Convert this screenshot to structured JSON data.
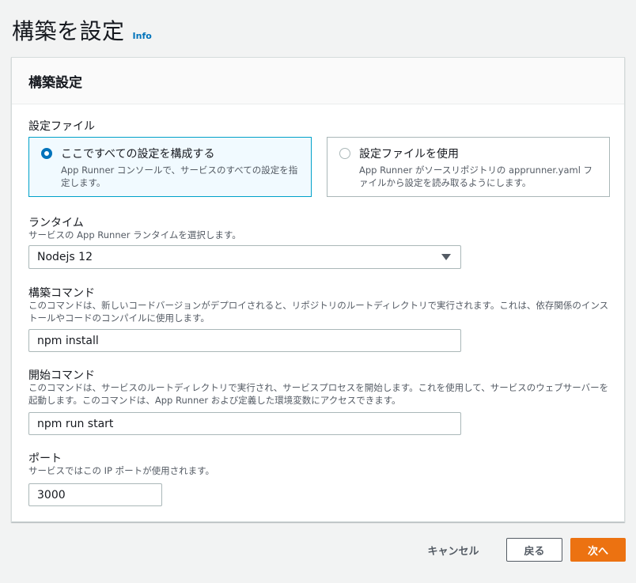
{
  "page": {
    "title": "構築を設定",
    "info_link": "Info"
  },
  "panel": {
    "title": "構築設定",
    "config_file": {
      "label": "設定ファイル",
      "options": [
        {
          "title": "ここですべての設定を構成する",
          "description": "App Runner コンソールで、サービスのすべての設定を指定します。",
          "selected": true
        },
        {
          "title": "設定ファイルを使用",
          "description": "App Runner がソースリポジトリの apprunner.yaml ファイルから設定を読み取るようにします。",
          "selected": false
        }
      ]
    },
    "runtime": {
      "label": "ランタイム",
      "description": "サービスの App Runner ランタイムを選択します。",
      "value": "Nodejs 12"
    },
    "build_command": {
      "label": "構築コマンド",
      "description": "このコマンドは、新しいコードバージョンがデプロイされると、リポジトリのルートディレクトリで実行されます。これは、依存関係のインストールやコードのコンパイルに使用します。",
      "value": "npm install"
    },
    "start_command": {
      "label": "開始コマンド",
      "description": "このコマンドは、サービスのルートディレクトリで実行され、サービスプロセスを開始します。これを使用して、サービスのウェブサーバーを起動します。このコマンドは、App Runner および定義した環境変数にアクセスできます。",
      "value": "npm run start"
    },
    "port": {
      "label": "ポート",
      "description": "サービスではこの IP ポートが使用されます。",
      "value": "3000"
    }
  },
  "footer": {
    "cancel_label": "キャンセル",
    "back_label": "戻る",
    "next_label": "次へ"
  },
  "colors": {
    "primary": "#ec7211",
    "link": "#0073bb",
    "selected_border": "#00a1c9",
    "selected_bg": "#f1faff"
  }
}
